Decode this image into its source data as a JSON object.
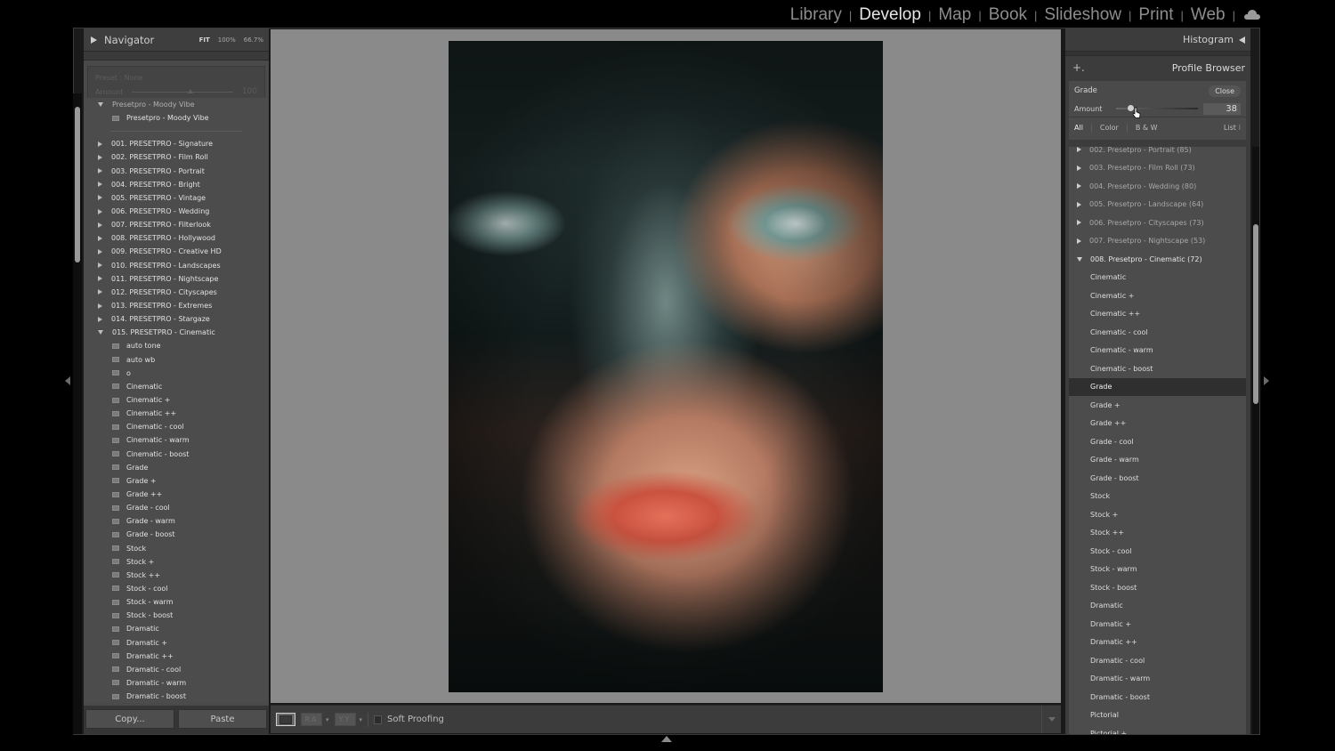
{
  "app": {
    "modules": [
      "Library",
      "Develop",
      "Map",
      "Book",
      "Slideshow",
      "Print",
      "Web"
    ],
    "active_module": "Develop",
    "cloud_icon": "cloud-icon"
  },
  "left_panel": {
    "navigator": {
      "title": "Navigator",
      "zoom_options": [
        "FIT",
        "100%",
        "66.7%"
      ],
      "active_zoom": "FIT"
    },
    "preset_amount": {
      "preset_label": "Preset : None",
      "amount_label": "Amount",
      "amount_value": "100",
      "amount_fraction": 0.55
    },
    "moody_group": {
      "label": "Presetpro - Moody Vibe",
      "items": [
        "Presetpro - Moody Vibe"
      ]
    },
    "preset_groups": [
      {
        "label": "001. PRESETPRO - Signature",
        "expanded": false
      },
      {
        "label": "002. PRESETPRO - Film Roll",
        "expanded": false
      },
      {
        "label": "003. PRESETPRO - Portrait",
        "expanded": false
      },
      {
        "label": "004. PRESETPRO - Bright",
        "expanded": false
      },
      {
        "label": "005. PRESETPRO - Vintage",
        "expanded": false
      },
      {
        "label": "006. PRESETPRO - Wedding",
        "expanded": false
      },
      {
        "label": "007. PRESETPRO - Filterlook",
        "expanded": false
      },
      {
        "label": "008. PRESETPRO - Hollywood",
        "expanded": false
      },
      {
        "label": "009. PRESETPRO - Creative HD",
        "expanded": false
      },
      {
        "label": "010. PRESETPRO - Landscapes",
        "expanded": false
      },
      {
        "label": "011. PRESETPRO - Nightscape",
        "expanded": false
      },
      {
        "label": "012. PRESETPRO - Cityscapes",
        "expanded": false
      },
      {
        "label": "013. PRESETPRO - Extremes",
        "expanded": false
      },
      {
        "label": "014. PRESETPRO - Stargaze",
        "expanded": false
      },
      {
        "label": "015. PRESETPRO - Cinematic",
        "expanded": true
      }
    ],
    "cinematic_presets": [
      "auto tone",
      "auto wb",
      "o",
      "Cinematic",
      "Cinematic +",
      "Cinematic ++",
      "Cinematic - cool",
      "Cinematic - warm",
      "Cinematic - boost",
      "Grade",
      "Grade +",
      "Grade ++",
      "Grade - cool",
      "Grade - warm",
      "Grade - boost",
      "Stock",
      "Stock +",
      "Stock ++",
      "Stock - cool",
      "Stock - warm",
      "Stock - boost",
      "Dramatic",
      "Dramatic +",
      "Dramatic ++",
      "Dramatic - cool",
      "Dramatic - warm",
      "Dramatic - boost"
    ],
    "copy_label": "Copy...",
    "paste_label": "Paste"
  },
  "toolbar": {
    "loupe_icon": "loupe-view-icon",
    "compare_label": "RA",
    "survey_label": "YY",
    "soft_proofing_label": "Soft Proofing",
    "soft_proofing_checked": false
  },
  "right_panel": {
    "histogram_title": "Histogram",
    "profile_browser": {
      "add_label": "+.",
      "title": "Profile Browser",
      "current_profile": "Grade",
      "close_label": "Close",
      "amount_label": "Amount",
      "amount_value": "38",
      "amount_fraction": 0.14,
      "filter_tabs": [
        "All",
        "Color",
        "B & W"
      ],
      "active_filter": "All",
      "view_mode": "List"
    },
    "profile_groups": [
      {
        "label": "002. Presetpro - Portrait (85)",
        "expanded": false
      },
      {
        "label": "003. Presetpro - Film Roll (73)",
        "expanded": false
      },
      {
        "label": "004. Presetpro - Wedding (80)",
        "expanded": false
      },
      {
        "label": "005. Presetpro - Landscape (64)",
        "expanded": false
      },
      {
        "label": "006. Presetpro - Cityscapes (73)",
        "expanded": false
      },
      {
        "label": "007. Presetpro - Nightscape (53)",
        "expanded": false
      },
      {
        "label": "008. Presetpro - Cinematic (72)",
        "expanded": true
      }
    ],
    "cinematic_profiles": [
      "Cinematic",
      "Cinematic +",
      "Cinematic ++",
      "Cinematic - cool",
      "Cinematic - warm",
      "Cinematic - boost",
      "Grade",
      "Grade +",
      "Grade ++",
      "Grade - cool",
      "Grade - warm",
      "Grade - boost",
      "Stock",
      "Stock +",
      "Stock ++",
      "Stock - cool",
      "Stock - warm",
      "Stock - boost",
      "Dramatic",
      "Dramatic +",
      "Dramatic ++",
      "Dramatic - cool",
      "Dramatic - warm",
      "Dramatic - boost",
      "Pictorial",
      "Pictorial +"
    ],
    "selected_profile": "Grade"
  },
  "photo": {
    "description": "Close-up portrait of a woman wearing a wet dark teal mask with water droplets, coral red lips"
  }
}
